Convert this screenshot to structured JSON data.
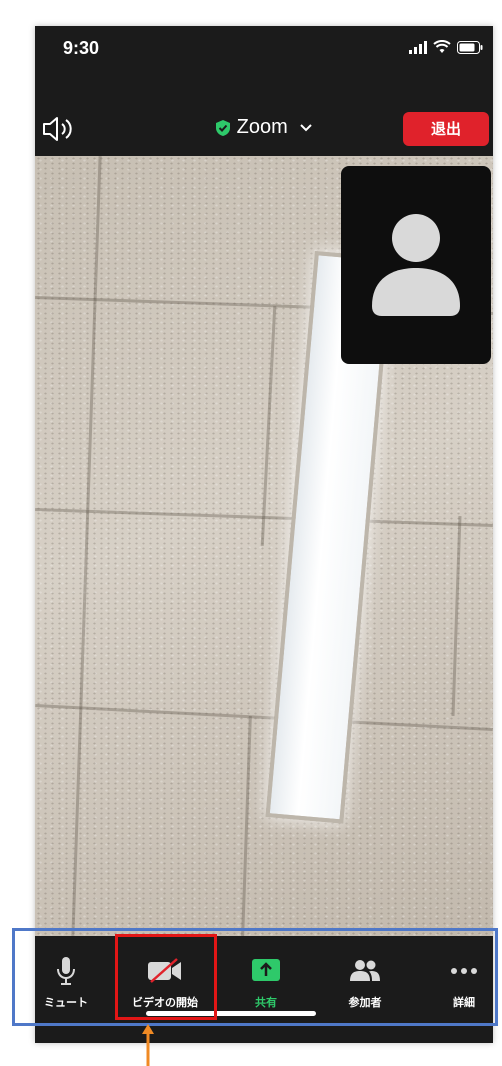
{
  "status_bar": {
    "time": "9:30"
  },
  "top_bar": {
    "meeting_name": "Zoom",
    "leave_label": "退出"
  },
  "toolbar": {
    "items": [
      {
        "label": "ミュート",
        "icon": "microphone-icon"
      },
      {
        "label": "ビデオの開始",
        "icon": "video-off-icon"
      },
      {
        "label": "共有",
        "icon": "share-screen-icon"
      },
      {
        "label": "参加者",
        "icon": "participants-icon"
      },
      {
        "label": "詳細",
        "icon": "more-icon"
      }
    ]
  },
  "colors": {
    "leave_button": "#e0222b",
    "share_accent": "#2ec96a",
    "highlight_blue": "#4f78c8",
    "highlight_red": "#e21616",
    "arrow_orange": "#f08a24"
  }
}
